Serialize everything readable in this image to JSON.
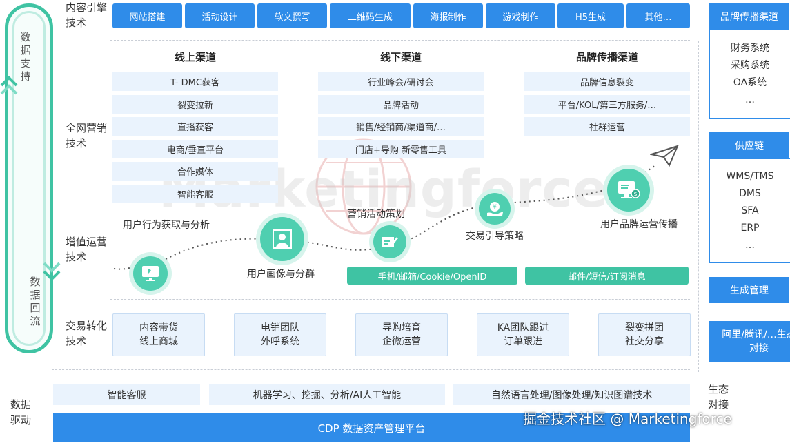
{
  "left_flow": {
    "top_label": "数据支持",
    "bottom_label": "数据回流"
  },
  "rows": {
    "content_engine": "内容引擎技术",
    "omni_marketing": "全网营销技术",
    "value_ops": "增值运营技术",
    "transaction": "交易转化技术",
    "data_driven": "数据驱动"
  },
  "content_tools": [
    "网站搭建",
    "活动设计",
    "软文撰写",
    "二维码生成",
    "海报制作",
    "游戏制作",
    "H5生成",
    "其他…"
  ],
  "channels": {
    "online": {
      "title": "线上渠道",
      "items": [
        "T- DMC获客",
        "裂变拉新",
        "直播获客",
        "电商/垂直平台",
        "合作媒体",
        "智能客服"
      ]
    },
    "offline": {
      "title": "线下渠道",
      "items": [
        "行业峰会/研讨会",
        "品牌活动",
        "销售/经销商/渠道商/…",
        "门店+导购 新零售工具"
      ]
    },
    "brand": {
      "title": "品牌传播渠道",
      "items": [
        "品牌信息裂变",
        "平台/KOL/第三方服务/…",
        "社群运营"
      ]
    }
  },
  "watermark": "Marketingforce",
  "journey": {
    "behavior": "用户行为获取与分析",
    "portrait": "用户画像与分群",
    "campaign": "营销活动策划",
    "guide": "交易引导策略",
    "brand_ops": "用户品牌运营传播",
    "id_bar": "手机/邮箱/Cookie/OpenID",
    "msg_bar": "邮件/短信/订阅消息"
  },
  "transaction_boxes": [
    {
      "line1": "内容带货",
      "line2": "线上商城"
    },
    {
      "line1": "电销团队",
      "line2": "外呼系统"
    },
    {
      "line1": "导购培育",
      "line2": "企微运营"
    },
    {
      "line1": "KA团队跟进",
      "line2": "订单跟进"
    },
    {
      "line1": "裂变拼团",
      "line2": "社交分享"
    }
  ],
  "data_tech": [
    "智能客服",
    "机器学习、挖掘、分析/AI人工智能",
    "自然语言处理/图像处理/知识图谱技术"
  ],
  "cdp": "CDP 数据资产管理平台",
  "right_panel": {
    "brand_channel": {
      "title": "品牌传播渠道",
      "items": [
        "财务系统",
        "采购系统",
        "OA系统",
        "…"
      ]
    },
    "supply_chain": {
      "title": "供应链",
      "items": [
        "WMS/TMS",
        "DMS",
        "SFA",
        "ERP",
        "…"
      ]
    },
    "production": "生成管理",
    "ecosystem": "阿里/腾讯/…生态对接",
    "eco_label": "生态对接"
  },
  "footer_watermark": "掘金技术社区 @ Marketingforce",
  "colors": {
    "blue": "#2f8ce9",
    "teal": "#3fc3a3",
    "light_blue": "#eaf3fd"
  }
}
